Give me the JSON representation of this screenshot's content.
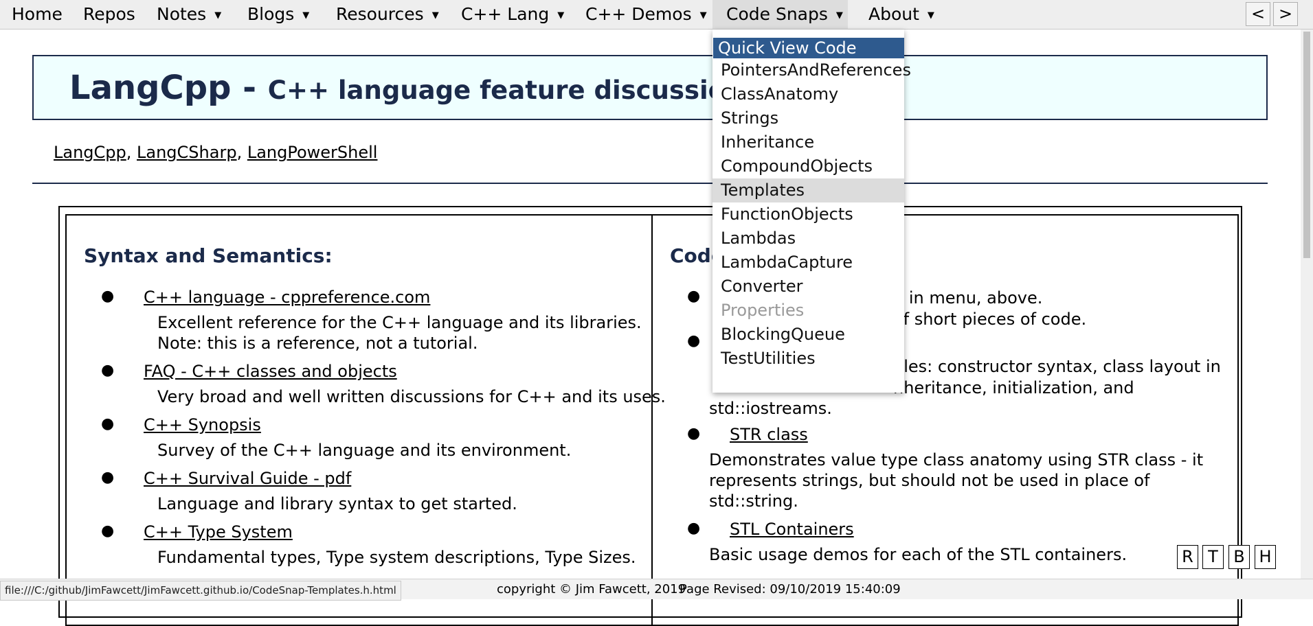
{
  "menu": {
    "items": [
      {
        "label": "Home",
        "has_caret": false
      },
      {
        "label": "Repos",
        "has_caret": false
      },
      {
        "label": "Notes",
        "has_caret": true
      },
      {
        "label": "Blogs",
        "has_caret": true
      },
      {
        "label": "Resources",
        "has_caret": true
      },
      {
        "label": "C++ Lang",
        "has_caret": true
      },
      {
        "label": "C++ Demos",
        "has_caret": true
      },
      {
        "label": "Code Snaps",
        "has_caret": true,
        "active": true
      },
      {
        "label": "About",
        "has_caret": true
      }
    ],
    "caret": "▼",
    "prev": "<",
    "next": ">"
  },
  "dropdown": {
    "header": "Quick View Code",
    "items": [
      {
        "label": "PointersAndReferences"
      },
      {
        "label": "ClassAnatomy"
      },
      {
        "label": "Strings"
      },
      {
        "label": "Inheritance"
      },
      {
        "label": "CompoundObjects"
      },
      {
        "label": "Templates",
        "hover": true
      },
      {
        "label": "FunctionObjects"
      },
      {
        "label": "Lambdas"
      },
      {
        "label": "LambdaCapture"
      },
      {
        "label": "Converter"
      },
      {
        "label": "Properties",
        "disabled": true
      },
      {
        "label": "BlockingQueue"
      },
      {
        "label": "TestUtilities"
      }
    ]
  },
  "banner": {
    "title": "LangCpp - ",
    "subtitle": "C++ language feature discussions a"
  },
  "lang_links": {
    "items": [
      "LangCpp",
      "LangCSharp",
      "LangPowerShell"
    ],
    "sep": ", "
  },
  "left": {
    "title": "Syntax and Semantics:",
    "entries": [
      {
        "link": "C++ language - cppreference.com",
        "desc": [
          "Excellent reference for the C++ language and its libraries.",
          "Note: this is a reference, not a tutorial."
        ]
      },
      {
        "link": "FAQ - C++ classes and objects",
        "desc": [
          "Very broad and well written discussions for C++ and its uses."
        ]
      },
      {
        "link": "C++ Synopsis",
        "desc": [
          "Survey of the C++ language and its environment."
        ]
      },
      {
        "link": "C++ Survival Guide - pdf",
        "desc": [
          "Language and library syntax to get started."
        ]
      },
      {
        "link": "C++ Type System",
        "desc": [
          "Fundamental types, Type system descriptions, Type Sizes."
        ]
      }
    ]
  },
  "right": {
    "title": "Code",
    "frag1": "n in menu, above.",
    "frag2": "of short pieces of code.",
    "frag3": "ples: constructor syntax, class layout in",
    "frag4": "nheritance, initialization, and",
    "frag5": "std::iostreams.",
    "entries": [
      {
        "link": "STR class",
        "desc": [
          "Demonstrates value type class anatomy using STR class - it",
          "represents strings, but should not be used in place of",
          "std::string."
        ]
      },
      {
        "link": "STL Containers",
        "desc": [
          "Basic usage demos for each of the STL containers."
        ]
      }
    ]
  },
  "corner_buttons": [
    "R",
    "T",
    "B",
    "H"
  ],
  "footer": {
    "status_url": "file:///C:/github/JimFawcett/JimFawcett.github.io/CodeSnap-Templates.h.html",
    "copyright": "copyright © Jim Fawcett, 2019",
    "revised": "Page Revised: 09/10/2019 15:40:09"
  }
}
